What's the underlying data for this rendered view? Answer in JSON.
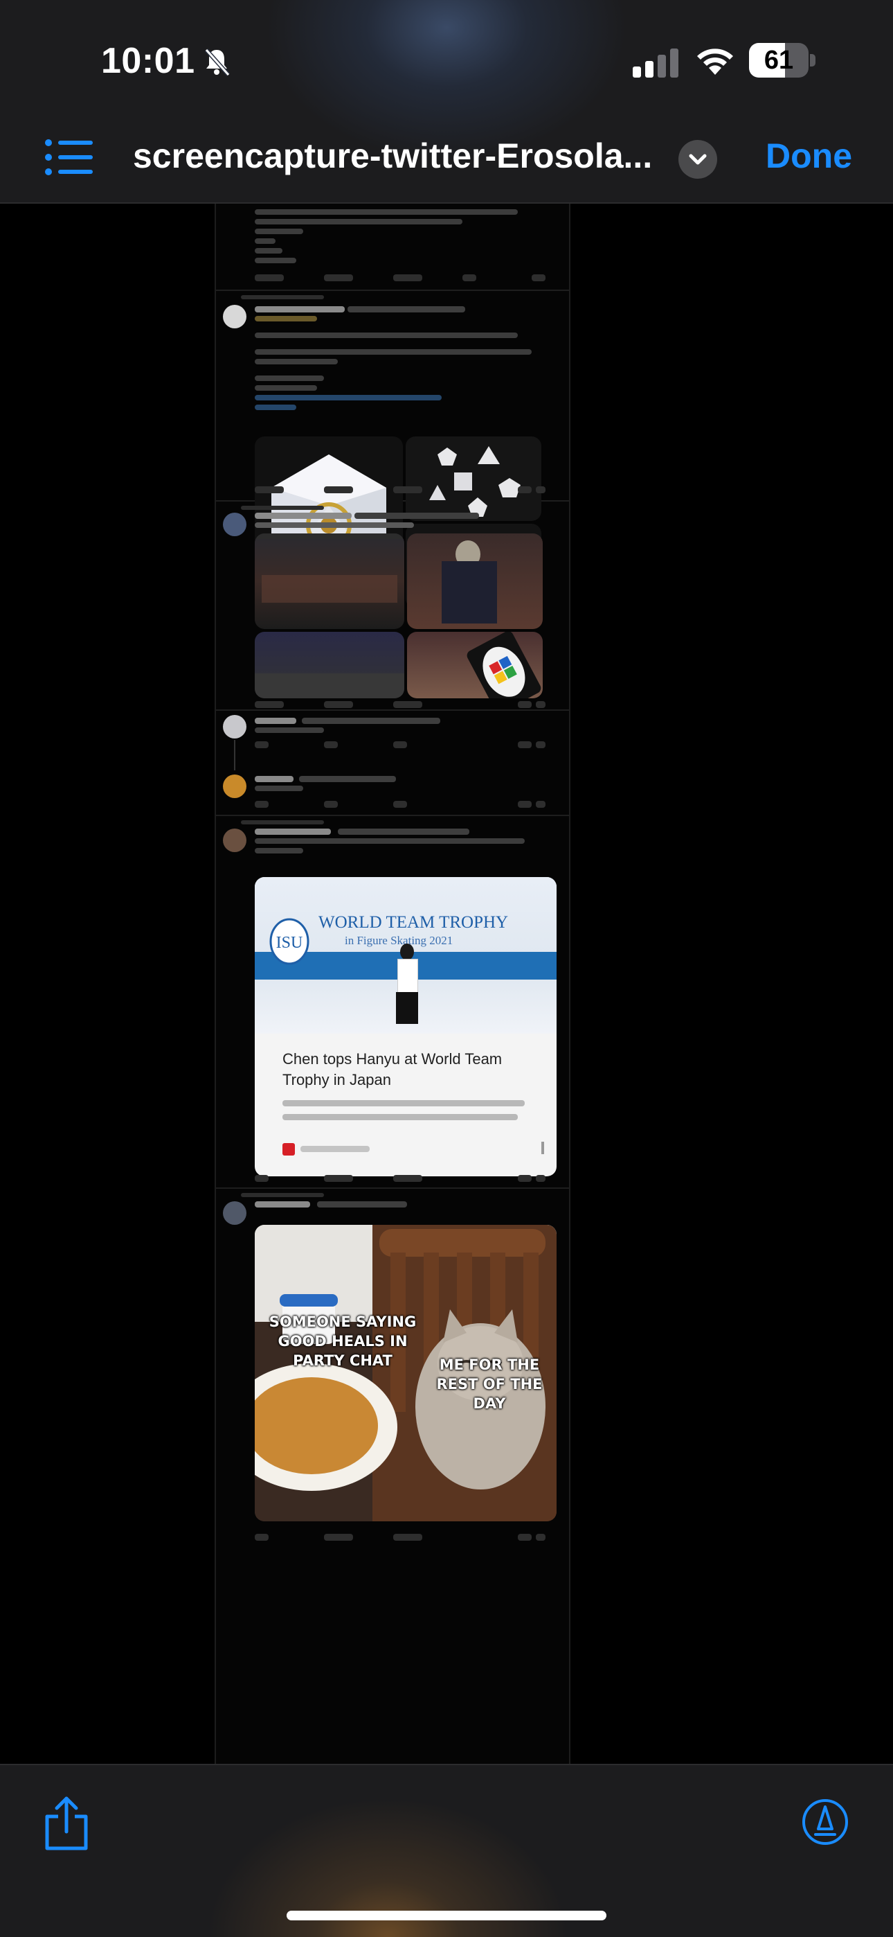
{
  "status_bar": {
    "time": "10:01",
    "battery": "61",
    "battery_level": 0.61
  },
  "toolbar": {
    "document_title": "screencapture-twitter-Erosola...",
    "done_label": "Done"
  },
  "content": {
    "news_card": {
      "headline": "Chen tops Hanyu at World Team Trophy in Japan",
      "image_text_line1": "WORLD TEAM TROPHY",
      "image_text_line2": "in Figure Skating 2021"
    },
    "meme": {
      "left_caption": "SOMEONE SAYING GOOD HEALS IN PARTY CHAT",
      "right_caption": "ME FOR THE REST OF THE DAY"
    }
  },
  "colors": {
    "accent": "#1a8cff",
    "chrome_background": "#1c1c1e",
    "page_background": "#000000"
  },
  "icons": {
    "list": "list-icon",
    "chevron": "chevron-down-icon",
    "share": "share-icon",
    "markup": "markup-pen-icon"
  }
}
